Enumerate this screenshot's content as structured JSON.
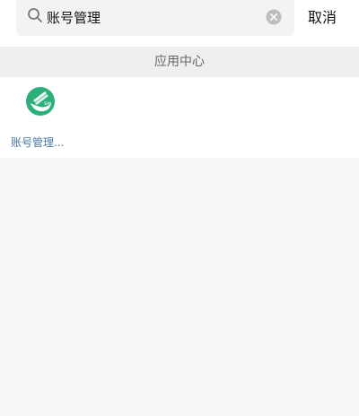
{
  "search": {
    "value": "账号管理",
    "cancel_label": "取消"
  },
  "section": {
    "title": "应用中心"
  },
  "results": [
    {
      "label": "账号管理...",
      "icon": "app-logo-icon",
      "icon_color": "#2bb07a"
    }
  ],
  "colors": {
    "accent_green": "#2bb07a",
    "label_blue": "#4a78a6"
  }
}
